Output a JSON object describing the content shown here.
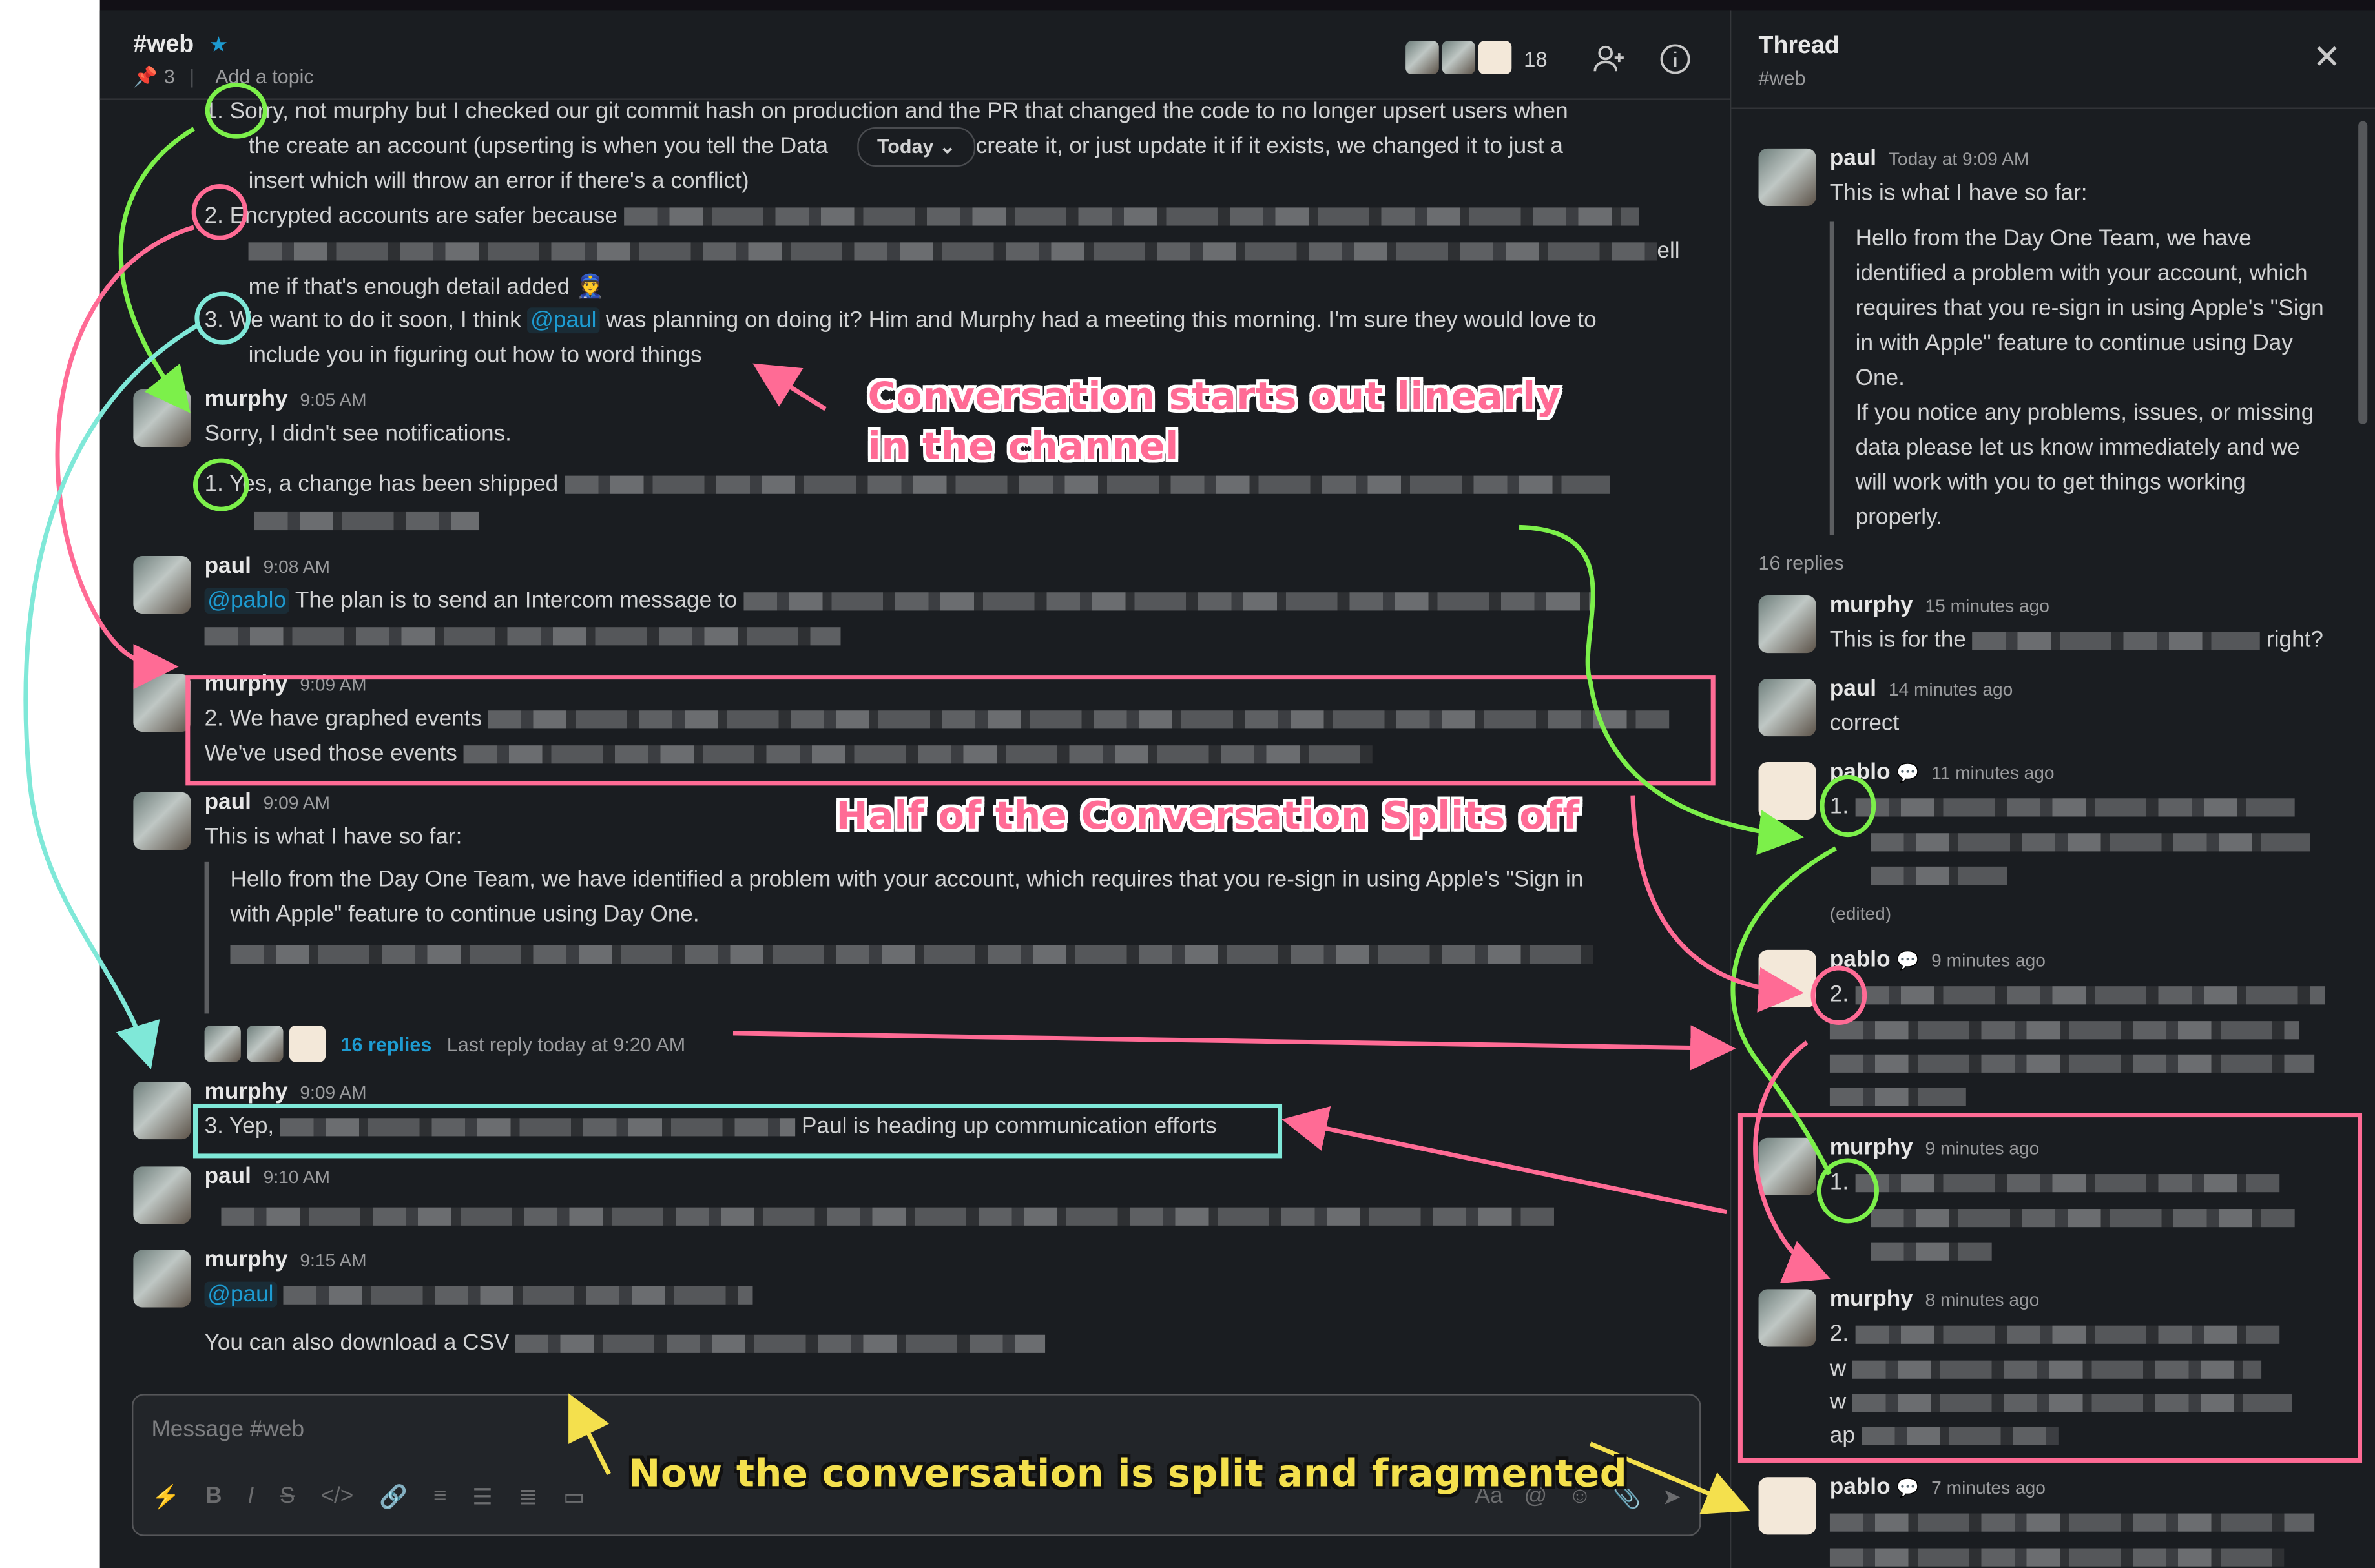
{
  "channel": {
    "name": "#web",
    "pins": "3",
    "topic_placeholder": "Add a topic",
    "member_count": "18",
    "date_pill": "Today"
  },
  "messages": {
    "top1": "1.  Sorry, not murphy but I checked our git commit hash on production and the PR that changed the code to no longer upsert users when",
    "top2": "the create an account (upserting is when you tell the Data",
    "top2b": "er create it, or just update it if it exists, we changed it to just a",
    "top3": "insert which will throw an error if there's a conflict)",
    "top4": "2.  Encrypted accounts are safer because",
    "top5b": "ell",
    "top6": "me if that's enough detail added",
    "top7a": "3.  We want to do it soon, I think",
    "top7mention": "@paul",
    "top7b": "was planning on doing it? Him and Murphy had a meeting this morning. I'm sure they would love to",
    "top8": "include you in figuring out how to word things",
    "m1_author": "murphy",
    "m1_time": "9:05 AM",
    "m1_l1": "Sorry, I didn't see notifications.",
    "m1_l2": "1.  Yes, a change has been shipped",
    "m2_author": "paul",
    "m2_time": "9:08 AM",
    "m2_mention": "@pablo",
    "m2_l1": "The plan is to send an Intercom message to",
    "m3_author": "murphy",
    "m3_time": "9:09 AM",
    "m3_l1": "2. We have graphed events",
    "m3_l2": "We've used those events",
    "m4_author": "paul",
    "m4_time": "9:09 AM",
    "m4_l1": "This is what I have so far:",
    "m4_q1": "Hello from the Day One Team, we have identified a problem with your account, which requires that you re-sign in using Apple's \"Sign in",
    "m4_q2": "with Apple\" feature to continue using Day One.",
    "m4_replies": "16 replies",
    "m4_last": "Last reply today at 9:20 AM",
    "m5_author": "murphy",
    "m5_time": "9:09 AM",
    "m5_l1a": "3. Yep,",
    "m5_l1b": "Paul is heading up communication efforts",
    "m6_author": "paul",
    "m6_time": "9:10 AM",
    "m7_author": "murphy",
    "m7_time": "9:15 AM",
    "m7_mention": "@paul",
    "m7_l2": "You can also download a CSV"
  },
  "composer": {
    "placeholder": "Message #web"
  },
  "thread": {
    "title": "Thread",
    "channel": "#web",
    "parent_author": "paul",
    "parent_time": "Today at 9:09 AM",
    "parent_l1": "This is what I have so far:",
    "parent_quote": [
      "Hello from the Day One Team, we have",
      "identified a problem with your account, which",
      "requires that you re-sign in using Apple's \"Sign",
      "in with Apple\" feature to continue using Day",
      "One.",
      "If you notice any problems, issues, or missing",
      "data please let us know immediately and we",
      "will work with you to get things working",
      "properly."
    ],
    "reply_count": "16 replies",
    "r1_author": "murphy",
    "r1_time": "15 minutes ago",
    "r1_a": "This is for the",
    "r1_b": "right?",
    "r2_author": "paul",
    "r2_time": "14 minutes ago",
    "r2_l1": "correct",
    "r3_author": "pablo",
    "r3_time": "11 minutes ago",
    "r3_num": "1.",
    "r3_edited": "(edited)",
    "r4_author": "pablo",
    "r4_time": "9 minutes ago",
    "r4_num": "2.",
    "r5_author": "murphy",
    "r5_time": "9 minutes ago",
    "r5_num": "1.",
    "r6_author": "murphy",
    "r6_time": "8 minutes ago",
    "r6_num": "2.",
    "r6_l2": "w",
    "r6_l3": "w",
    "r6_l4": "ap",
    "r7_author": "pablo",
    "r7_time": "7 minutes ago"
  },
  "annotations": {
    "linear": [
      "Conversation starts out linearly",
      "in the channel"
    ],
    "split": "Half of the Conversation Splits off",
    "fragmented": "Now the conversation is split and fragmented"
  },
  "colors": {
    "pink": "#ff6b95",
    "green": "#7cf04a",
    "cyan": "#7fe8d8",
    "yellow": "#f4e04d",
    "mention": "#1d9bd1"
  }
}
